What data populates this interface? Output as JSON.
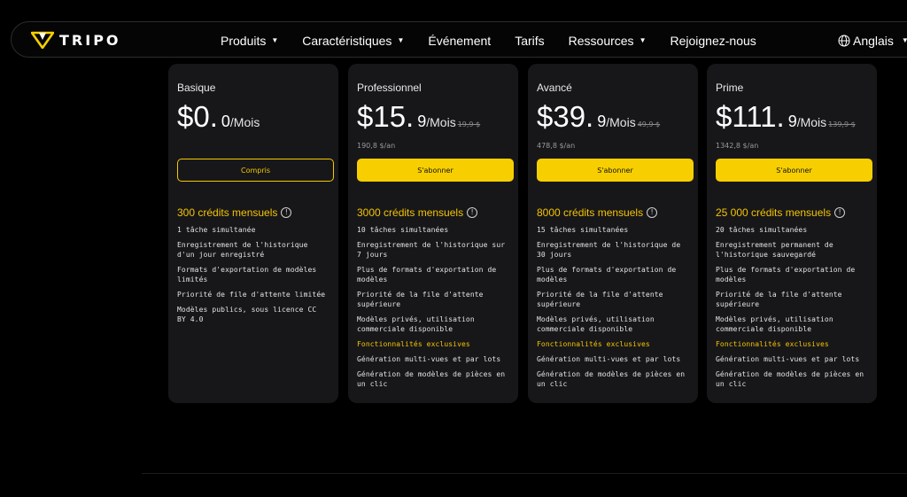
{
  "brand": {
    "name": "TRIPO",
    "accent": "#f7cf00"
  },
  "nav": {
    "items": [
      {
        "label": "Produits",
        "dropdown": true
      },
      {
        "label": "Caractéristiques",
        "dropdown": true
      },
      {
        "label": "Événement",
        "dropdown": false
      },
      {
        "label": "Tarifs",
        "dropdown": false
      },
      {
        "label": "Ressources",
        "dropdown": true
      },
      {
        "label": "Rejoignez-nous",
        "dropdown": false
      }
    ],
    "language": "Anglais"
  },
  "plans": [
    {
      "name": "Basique",
      "price_main": "$0.",
      "price_dec": "0",
      "unit": "/Mois",
      "old_price": "",
      "yearly": "",
      "button": "Compris",
      "button_style": "outline",
      "credits": "300 crédits mensuels",
      "features": [
        "1 tâche simultanée",
        "Enregistrement de l'historique d'un jour enregistré",
        "Formats d'exportation de modèles limités",
        "Priorité de file d'attente limitée",
        "Modèles publics, sous licence CC BY 4.0"
      ],
      "exclusive_title": "",
      "exclusive": []
    },
    {
      "name": "Professionnel",
      "price_main": "$15.",
      "price_dec": "9",
      "unit": "/Mois",
      "old_price": "19,9 $",
      "yearly": "190,8 $/an",
      "button": "S'abonner",
      "button_style": "solid",
      "credits": "3000 crédits mensuels",
      "features": [
        "10 tâches simultanées",
        "Enregistrement de l'historique sur 7 jours",
        "Plus de formats d'exportation de modèles",
        "Priorité de la file d'attente supérieure",
        "Modèles privés, utilisation commerciale disponible"
      ],
      "exclusive_title": "Fonctionnalités exclusives",
      "exclusive": [
        "Génération multi-vues et par lots",
        "Génération de modèles de pièces en un clic"
      ]
    },
    {
      "name": "Avancé",
      "price_main": "$39.",
      "price_dec": "9",
      "unit": "/Mois",
      "old_price": "49,9 $",
      "yearly": "478,8 $/an",
      "button": "S'abonner",
      "button_style": "solid",
      "credits": "8000 crédits mensuels",
      "features": [
        "15 tâches simultanées",
        "Enregistrement de l'historique de 30 jours",
        "Plus de formats d'exportation de modèles",
        "Priorité de la file d'attente supérieure",
        "Modèles privés, utilisation commerciale disponible"
      ],
      "exclusive_title": "Fonctionnalités exclusives",
      "exclusive": [
        "Génération multi-vues et par lots",
        "Génération de modèles de pièces en un clic"
      ]
    },
    {
      "name": "Prime",
      "price_main": "$111.",
      "price_dec": "9",
      "unit": "/Mois",
      "old_price": "139,9 $",
      "yearly": "1342,8 $/an",
      "button": "S'abonner",
      "button_style": "solid",
      "credits": "25 000 crédits mensuels",
      "features": [
        "20 tâches simultanées",
        "Enregistrement permanent de l'historique sauvegardé",
        "Plus de formats d'exportation de modèles",
        "Priorité de la file d'attente supérieure",
        "Modèles privés, utilisation commerciale disponible"
      ],
      "exclusive_title": "Fonctionnalités exclusives",
      "exclusive": [
        "Génération multi-vues et par lots",
        "Génération de modèles de pièces en un clic"
      ]
    }
  ]
}
